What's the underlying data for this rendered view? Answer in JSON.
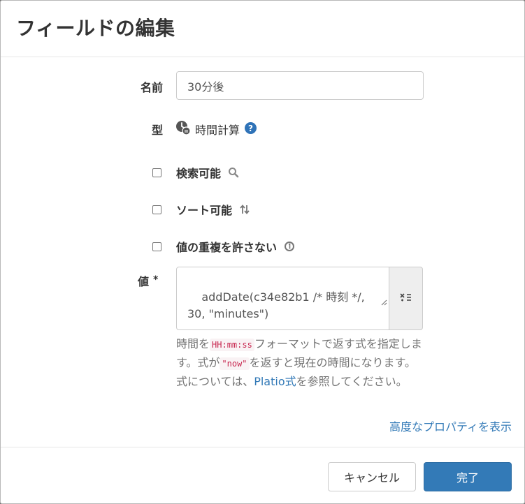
{
  "dialog": {
    "title": "フィールドの編集"
  },
  "form": {
    "name_label": "名前",
    "name_value": "30分後",
    "type_label": "型",
    "type_value": "時間計算",
    "checkboxes": [
      {
        "label": "検索可能",
        "checked": false,
        "icon": "search-icon"
      },
      {
        "label": "ソート可能",
        "checked": false,
        "icon": "sort-icon"
      },
      {
        "label": "値の重複を許さない",
        "checked": false,
        "icon": "unique-icon"
      }
    ],
    "value_label": "値",
    "required_mark": "*",
    "value_expression": "addDate(c34e82b1 /* 時刻 */,\n30, \"minutes\")",
    "help": {
      "part1": "時間を",
      "code1": "HH:mm:ss",
      "part2": "フォーマットで返す式を指定します。式が",
      "code2": "\"now\"",
      "part3": "を返すと現在の時間になります。式については、",
      "link": "Platio式",
      "part4": "を参照してください。"
    },
    "advanced_link": "高度なプロパティを表示"
  },
  "footer": {
    "cancel_label": "キャンセル",
    "done_label": "完了"
  },
  "colors": {
    "primary": "#337ab7",
    "code_text": "#c7254e",
    "help_text": "#737373"
  }
}
